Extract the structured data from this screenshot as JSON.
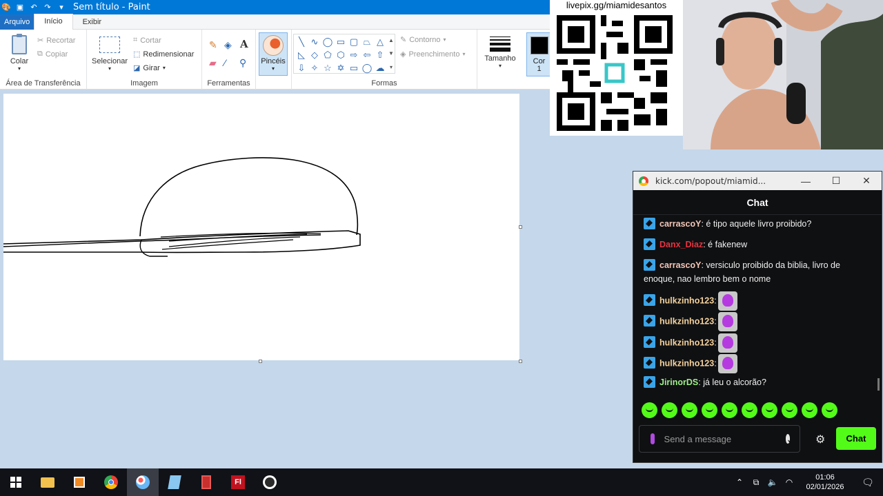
{
  "window": {
    "title": "Sem título - Paint"
  },
  "menu": {
    "file": "Arquivo",
    "tabs": [
      "Início",
      "Exibir"
    ]
  },
  "ribbon": {
    "clipboard": {
      "paste": "Colar",
      "cut": "Recortar",
      "copy": "Copiar",
      "group_label": "Área de Transferência"
    },
    "image": {
      "select": "Selecionar",
      "crop": "Cortar",
      "resize": "Redimensionar",
      "rotate": "Girar",
      "group_label": "Imagem"
    },
    "tools": {
      "group_label": "Ferramentas",
      "brushes": "Pincéis"
    },
    "shapes": {
      "outline": "Contorno",
      "fill": "Preenchimento",
      "group_label": "Formas"
    },
    "size": "Tamanho",
    "color1_line1": "Cor",
    "color1_line2": "1"
  },
  "overlay": {
    "qr_label": "livepix.gg/miamidesantos"
  },
  "chat": {
    "url": "kick.com/popout/miamid...",
    "header": "Chat",
    "messages": [
      {
        "user": "carrascoY",
        "text": ": é tipo aquele livro proibido?",
        "color": "#f4c7b8"
      },
      {
        "user": "Danx_Diaz",
        "text": ": é fakenew",
        "color": "#e8333f"
      },
      {
        "user": "carrascoY",
        "text": ": versiculo proibido da biblia, livro de enoque, nao lembro bem o nome",
        "color": "#f4c7b8"
      },
      {
        "user": "hulkzinho123",
        "text": ":",
        "color": "#f5d29c"
      },
      {
        "user": "hulkzinho123",
        "text": ":",
        "color": "#f5d29c"
      },
      {
        "user": "hulkzinho123",
        "text": ":",
        "color": "#f5d29c"
      },
      {
        "user": "hulkzinho123",
        "text": ":",
        "color": "#f5d29c"
      },
      {
        "user": "JirinorDS",
        "text": ": já leu o alcorão?",
        "color": "#9ef08a"
      }
    ],
    "input_placeholder": "Send a message",
    "send_label": "Chat",
    "accent": "#53fc18"
  },
  "taskbar": {
    "time": "01:06",
    "date": "02/01/2026",
    "apps": [
      "start-icon",
      "file-explorer-icon",
      "media-player-icon",
      "chrome-icon",
      "paint-icon",
      "notepad-icon",
      "calculator-icon",
      "flash-icon",
      "obs-icon"
    ]
  }
}
